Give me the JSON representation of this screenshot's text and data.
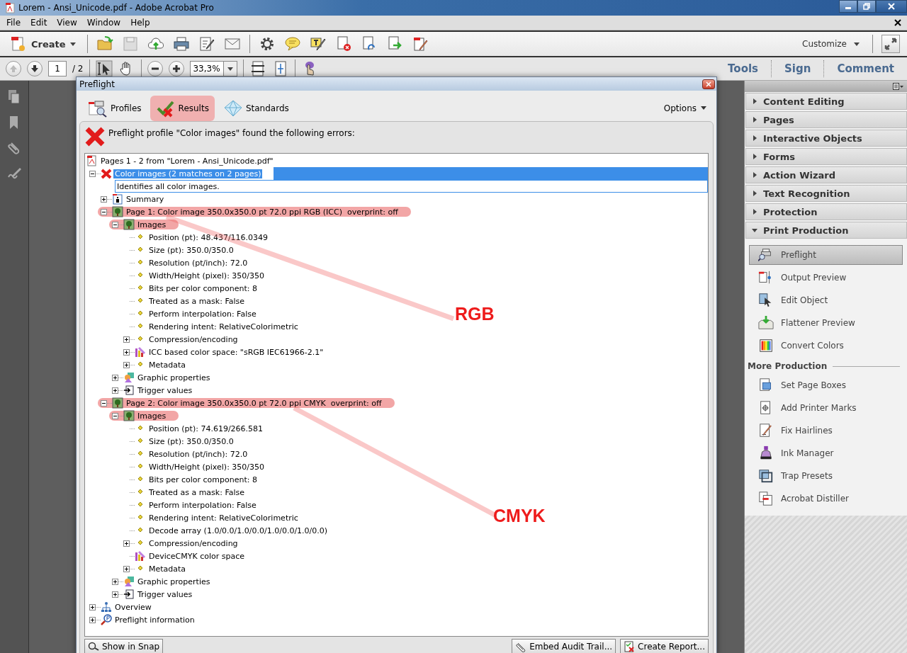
{
  "window": {
    "title": "Lorem - Ansi_Unicode.pdf - Adobe Acrobat Pro"
  },
  "menu": [
    "File",
    "Edit",
    "View",
    "Window",
    "Help"
  ],
  "toolbar": {
    "create": "Create",
    "customize": "Customize"
  },
  "nav": {
    "page": "1",
    "page_count": "/ 2",
    "zoom": "33,3%",
    "panes": [
      "Tools",
      "Sign",
      "Comment"
    ]
  },
  "dialog": {
    "title": "Preflight",
    "options": "Options",
    "tabs": [
      {
        "label": "Profiles",
        "kind": "profiles",
        "selected": false
      },
      {
        "label": "Results",
        "kind": "results",
        "selected": true
      },
      {
        "label": "Standards",
        "kind": "standards",
        "selected": false
      }
    ],
    "message": "Preflight profile \"Color images\" found the following errors:",
    "tree": {
      "label": "Pages 1 - 2 from \"Lorem - Ansi_Unicode.pdf\"",
      "kind": "pdf",
      "selected": false,
      "highlighted": false,
      "children": [
        {
          "label": "Color images (2 matches on 2 pages)",
          "kind": "error",
          "expanded": true,
          "selected": true,
          "highlighted": false,
          "description": "Identifies all color images.",
          "children": [
            {
              "label": "Summary",
              "kind": "summary",
              "expanded": false,
              "selected": false,
              "highlighted": false
            },
            {
              "label": "Page 1: Color image 350.0x350.0 pt 72.0 ppi RGB (ICC)  overprint: off",
              "kind": "image",
              "expanded": true,
              "selected": false,
              "highlighted": true,
              "children": [
                {
                  "label": "Images",
                  "kind": "image",
                  "expanded": true,
                  "selected": false,
                  "highlighted": true,
                  "children": [
                    {
                      "label": "Position (pt): 48.437/116.0349",
                      "kind": "property",
                      "selected": false,
                      "highlighted": false
                    },
                    {
                      "label": "Size (pt): 350.0/350.0",
                      "kind": "property",
                      "selected": false,
                      "highlighted": false
                    },
                    {
                      "label": "Resolution (pt/inch): 72.0",
                      "kind": "property",
                      "selected": false,
                      "highlighted": false
                    },
                    {
                      "label": "Width/Height (pixel): 350/350",
                      "kind": "property",
                      "selected": false,
                      "highlighted": false
                    },
                    {
                      "label": "Bits per color component: 8",
                      "kind": "property",
                      "selected": false,
                      "highlighted": false
                    },
                    {
                      "label": "Treated as a mask: False",
                      "kind": "property",
                      "selected": false,
                      "highlighted": false
                    },
                    {
                      "label": "Perform interpolation: False",
                      "kind": "property",
                      "selected": false,
                      "highlighted": false
                    },
                    {
                      "label": "Rendering intent: RelativeColorimetric",
                      "kind": "property",
                      "selected": false,
                      "highlighted": false
                    },
                    {
                      "label": "Compression/encoding",
                      "kind": "property",
                      "expanded": false,
                      "selected": false,
                      "highlighted": false
                    },
                    {
                      "label": "ICC based color space: \"sRGB IEC61966-2.1\"",
                      "kind": "colorspace",
                      "expanded": false,
                      "selected": false,
                      "highlighted": false
                    },
                    {
                      "label": "Metadata",
                      "kind": "property",
                      "expanded": false,
                      "selected": false,
                      "highlighted": false
                    }
                  ]
                },
                {
                  "label": "Graphic properties",
                  "kind": "graphic",
                  "expanded": false,
                  "selected": false,
                  "highlighted": false
                },
                {
                  "label": "Trigger values",
                  "kind": "trigger",
                  "expanded": false,
                  "selected": false,
                  "highlighted": false
                }
              ]
            },
            {
              "label": "Page 2: Color image 350.0x350.0 pt 72.0 ppi CMYK  overprint: off",
              "kind": "image",
              "expanded": true,
              "selected": false,
              "highlighted": true,
              "children": [
                {
                  "label": "Images",
                  "kind": "image",
                  "expanded": true,
                  "selected": false,
                  "highlighted": true,
                  "children": [
                    {
                      "label": "Position (pt): 74.619/266.581",
                      "kind": "property",
                      "selected": false,
                      "highlighted": false
                    },
                    {
                      "label": "Size (pt): 350.0/350.0",
                      "kind": "property",
                      "selected": false,
                      "highlighted": false
                    },
                    {
                      "label": "Resolution (pt/inch): 72.0",
                      "kind": "property",
                      "selected": false,
                      "highlighted": false
                    },
                    {
                      "label": "Width/Height (pixel): 350/350",
                      "kind": "property",
                      "selected": false,
                      "highlighted": false
                    },
                    {
                      "label": "Bits per color component: 8",
                      "kind": "property",
                      "selected": false,
                      "highlighted": false
                    },
                    {
                      "label": "Treated as a mask: False",
                      "kind": "property",
                      "selected": false,
                      "highlighted": false
                    },
                    {
                      "label": "Perform interpolation: False",
                      "kind": "property",
                      "selected": false,
                      "highlighted": false
                    },
                    {
                      "label": "Rendering intent: RelativeColorimetric",
                      "kind": "property",
                      "selected": false,
                      "highlighted": false
                    },
                    {
                      "label": "Decode array (1.0/0.0/1.0/0.0/1.0/0.0/1.0/0.0)",
                      "kind": "property",
                      "selected": false,
                      "highlighted": false
                    },
                    {
                      "label": "Compression/encoding",
                      "kind": "property",
                      "expanded": false,
                      "selected": false,
                      "highlighted": false
                    },
                    {
                      "label": "DeviceCMYK color space",
                      "kind": "colorspace",
                      "selected": false,
                      "highlighted": false
                    },
                    {
                      "label": "Metadata",
                      "kind": "property",
                      "expanded": false,
                      "selected": false,
                      "highlighted": false
                    }
                  ]
                },
                {
                  "label": "Graphic properties",
                  "kind": "graphic",
                  "expanded": false,
                  "selected": false,
                  "highlighted": false
                },
                {
                  "label": "Trigger values",
                  "kind": "trigger",
                  "expanded": false,
                  "selected": false,
                  "highlighted": false
                }
              ]
            }
          ]
        },
        {
          "label": "Overview",
          "kind": "overview",
          "expanded": false,
          "selected": false,
          "highlighted": false
        },
        {
          "label": "Preflight information",
          "kind": "info",
          "expanded": false,
          "selected": false,
          "highlighted": false
        }
      ]
    },
    "buttons": [
      {
        "label": "Show in Snap",
        "kind": "snap"
      },
      {
        "label": "Embed Audit Trail...",
        "kind": "clip"
      },
      {
        "label": "Create Report...",
        "kind": "report"
      }
    ]
  },
  "annotations": [
    {
      "label": "RGB"
    },
    {
      "label": "CMYK"
    }
  ],
  "panel": {
    "sections": [
      {
        "label": "Content Editing",
        "expanded": false
      },
      {
        "label": "Pages",
        "expanded": false
      },
      {
        "label": "Interactive Objects",
        "expanded": false
      },
      {
        "label": "Forms",
        "expanded": false
      },
      {
        "label": "Action Wizard",
        "expanded": false
      },
      {
        "label": "Text Recognition",
        "expanded": false
      },
      {
        "label": "Protection",
        "expanded": false
      },
      {
        "label": "Print Production",
        "expanded": true,
        "tools": [
          {
            "label": "Preflight",
            "kind": "preflight",
            "selected": true
          },
          {
            "label": "Output Preview",
            "kind": "output",
            "selected": false
          },
          {
            "label": "Edit Object",
            "kind": "edit",
            "selected": false
          },
          {
            "label": "Flattener Preview",
            "kind": "flatten",
            "selected": false
          },
          {
            "label": "Convert Colors",
            "kind": "colors",
            "selected": false
          }
        ],
        "more_heading": "More Production",
        "more_tools": [
          {
            "label": "Set Page Boxes",
            "kind": "boxes",
            "selected": false
          },
          {
            "label": "Add Printer Marks",
            "kind": "marks",
            "selected": false
          },
          {
            "label": "Fix Hairlines",
            "kind": "hairlines",
            "selected": false
          },
          {
            "label": "Ink Manager",
            "kind": "ink",
            "selected": false
          },
          {
            "label": "Trap Presets",
            "kind": "trap",
            "selected": false
          },
          {
            "label": "Acrobat Distiller",
            "kind": "distiller",
            "selected": false
          }
        ]
      }
    ]
  }
}
